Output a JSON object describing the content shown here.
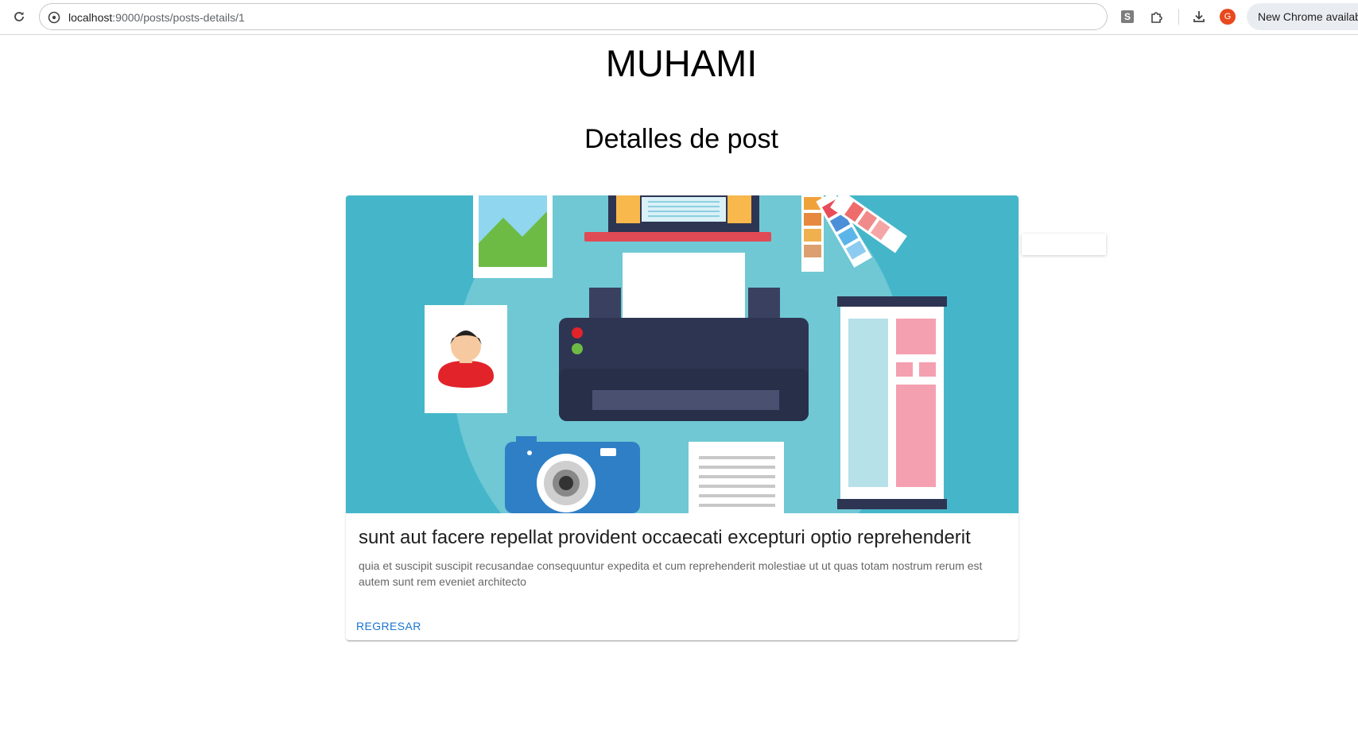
{
  "browser": {
    "url_host": "localhost",
    "url_path": ":9000/posts/posts-details/1",
    "profile_initial": "G",
    "ext_letter": "S",
    "update_notice": "New Chrome available"
  },
  "page": {
    "site_title": "MUHAMI",
    "heading": "Detalles de post"
  },
  "post": {
    "title": "sunt aut facere repellat provident occaecati excepturi optio reprehenderit",
    "body": "quia et suscipit suscipit recusandae consequuntur expedita et cum reprehenderit molestiae ut ut quas totam nostrum rerum est autem sunt rem eveniet architecto",
    "back_label": "REGRESAR",
    "image_icons": [
      "landscape-photo-icon",
      "laptop-icon",
      "color-swatch-icon",
      "user-portrait-icon",
      "printer-icon",
      "banner-stand-icon",
      "camera-icon",
      "document-icon"
    ]
  },
  "colors": {
    "link": "#1976d2",
    "image_bg": "#45b6c9",
    "image_circle": "#6fc8d4",
    "printer": "#2e3553"
  }
}
